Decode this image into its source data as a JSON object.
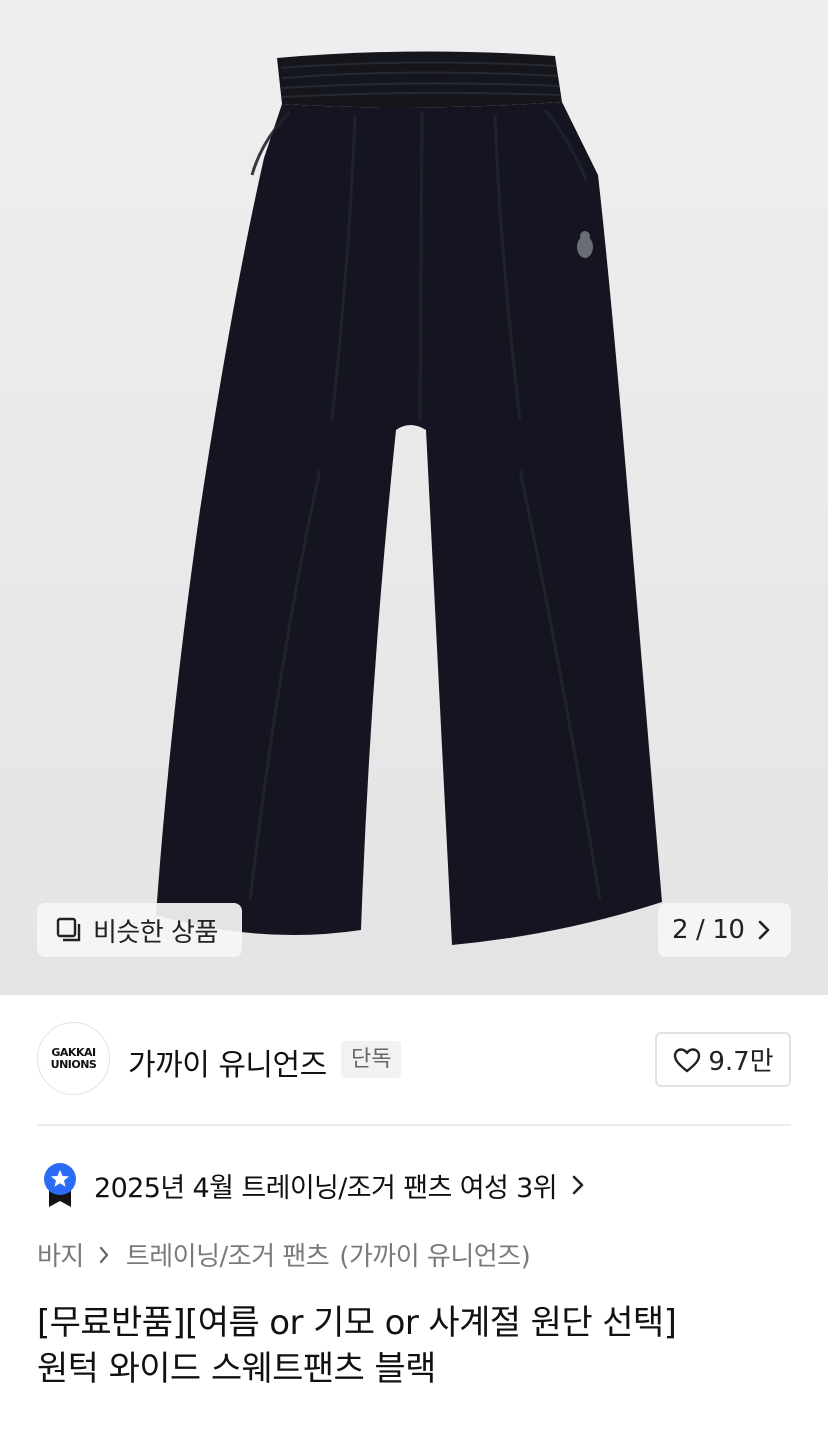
{
  "gallery": {
    "similar_label": "비슷한 상품",
    "current_index": "2",
    "separator": "/",
    "total": "10"
  },
  "brand": {
    "logo_line1": "GAKKAI",
    "logo_line2": "UNIONS",
    "name": "가까이 유니언즈",
    "badge": "단독",
    "likes": "9.7만"
  },
  "ranking": {
    "text": "2025년 4월 트레이닝/조거 팬츠 여성 3위",
    "accent_color": "#2a6cf6"
  },
  "breadcrumb": {
    "category": "바지",
    "subcategory": "트레이닝/조거 팬츠",
    "brand": "(가까이 유니언즈)"
  },
  "product": {
    "title_line1": "[무료반품][여름 or 기모 or 사계절 원단 선택]",
    "title_line2": "원턱 와이드 스웨트팬츠 블랙"
  }
}
